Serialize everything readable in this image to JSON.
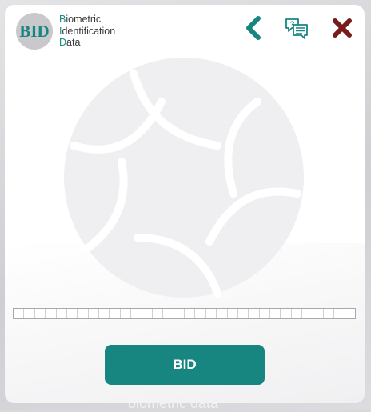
{
  "app": {
    "title_lines": [
      {
        "cap": "B",
        "rest": "iometric"
      },
      {
        "cap": "I",
        "rest": "dentification"
      },
      {
        "cap": "D",
        "rest": "ata"
      }
    ],
    "logo_text": "BID"
  },
  "toolbar": {
    "back_icon": "chevron-left-icon",
    "chat_icon": "chat-bubbles-icon",
    "close_icon": "close-icon"
  },
  "progress": {
    "segments": 32,
    "filled_fraction": 0
  },
  "actions": {
    "bid_label": "BID"
  },
  "background": {
    "footer_text": "biometric data"
  },
  "colors": {
    "brand_teal": "#178580",
    "close_red": "#7a1a1a"
  }
}
